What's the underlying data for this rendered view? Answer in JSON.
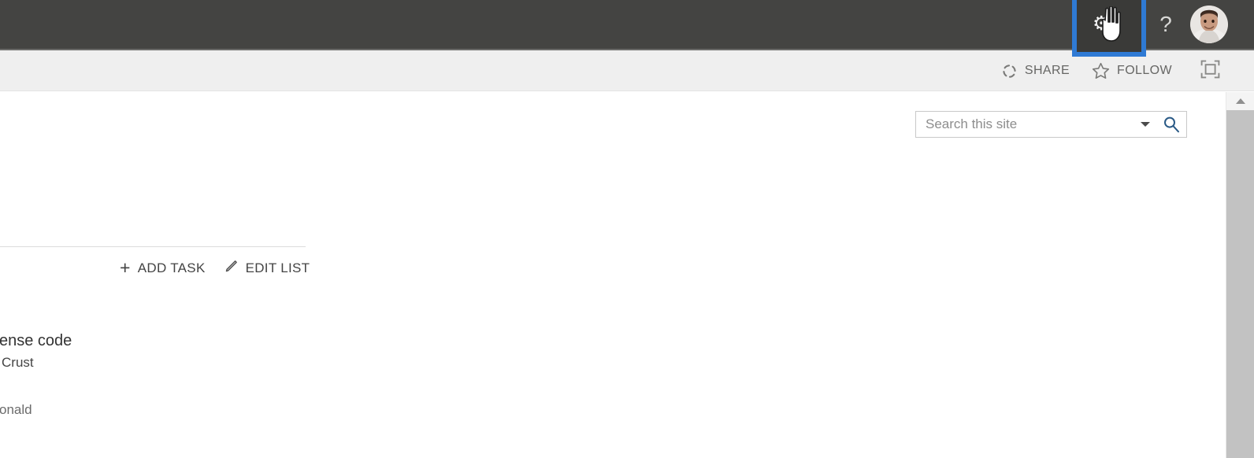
{
  "suite_bar": {
    "background": "#444442",
    "settings_button": {
      "label": "Settings",
      "icon": "gear-icon",
      "highlighted": true,
      "highlight_color": "#2f7ad4"
    },
    "help_button": {
      "label": "?",
      "icon": "question-mark-icon"
    },
    "avatar": {
      "label": "User photo",
      "icon": "user-avatar"
    },
    "cursor": {
      "type": "pointing-hand-cursor"
    }
  },
  "command_band": {
    "background": "#efefef",
    "items": [
      {
        "label": "SHARE",
        "icon": "share-icon"
      },
      {
        "label": "FOLLOW",
        "icon": "star-icon"
      }
    ],
    "focus_button": {
      "label": "Focus on content",
      "icon": "focus-on-content-icon"
    }
  },
  "search": {
    "placeholder": "Search this site",
    "value": "",
    "caret_icon": "chevron-down-icon",
    "submit_icon": "magnifier-icon"
  },
  "list_actions": [
    {
      "label": "ADD TASK",
      "icon": "plus-icon"
    },
    {
      "label": "EDIT LIST",
      "icon": "pencil-icon"
    }
  ],
  "task_item": {
    "title_clipped": "ense code",
    "subtitle_clipped": "Crust",
    "assignee_clipped": "onald"
  },
  "scrollbar": {
    "up_arrow_icon": "scroll-up-arrow-icon",
    "thumb_color": "#c2c2c2"
  }
}
